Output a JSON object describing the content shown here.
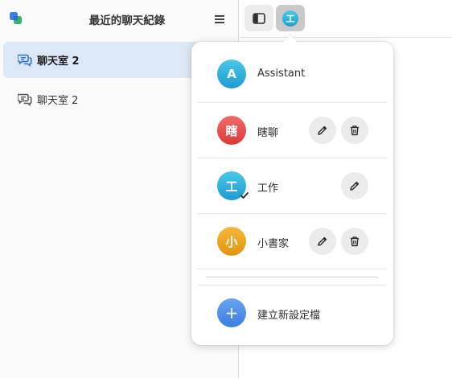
{
  "sidebar": {
    "title": "最近的聊天紀錄",
    "items": [
      {
        "label": "聊天室 2",
        "active": true
      },
      {
        "label": "聊天室 2",
        "active": false
      }
    ]
  },
  "popover": {
    "profiles": [
      {
        "initial": "A",
        "name": "Assistant",
        "color_top": "#4dc7e8",
        "color_bottom": "#1f9ad0",
        "editable": false,
        "deletable": false,
        "selected": false
      },
      {
        "initial": "瞎",
        "name": "瞎聊",
        "color_top": "#f36b6b",
        "color_bottom": "#d83a3a",
        "editable": true,
        "deletable": true,
        "selected": false
      },
      {
        "initial": "工",
        "name": "工作",
        "color_top": "#4dc7e8",
        "color_bottom": "#1f9ad0",
        "editable": true,
        "deletable": false,
        "selected": true
      },
      {
        "initial": "小",
        "name": "小書家",
        "color_top": "#f5b73a",
        "color_bottom": "#e29414",
        "editable": true,
        "deletable": true,
        "selected": false
      }
    ],
    "new_profile": {
      "initial": "+",
      "label": "建立新設定檔",
      "color_top": "#6aa3f0",
      "color_bottom": "#3b7de0"
    }
  },
  "toolbar": {
    "current_profile_initial": "工"
  }
}
